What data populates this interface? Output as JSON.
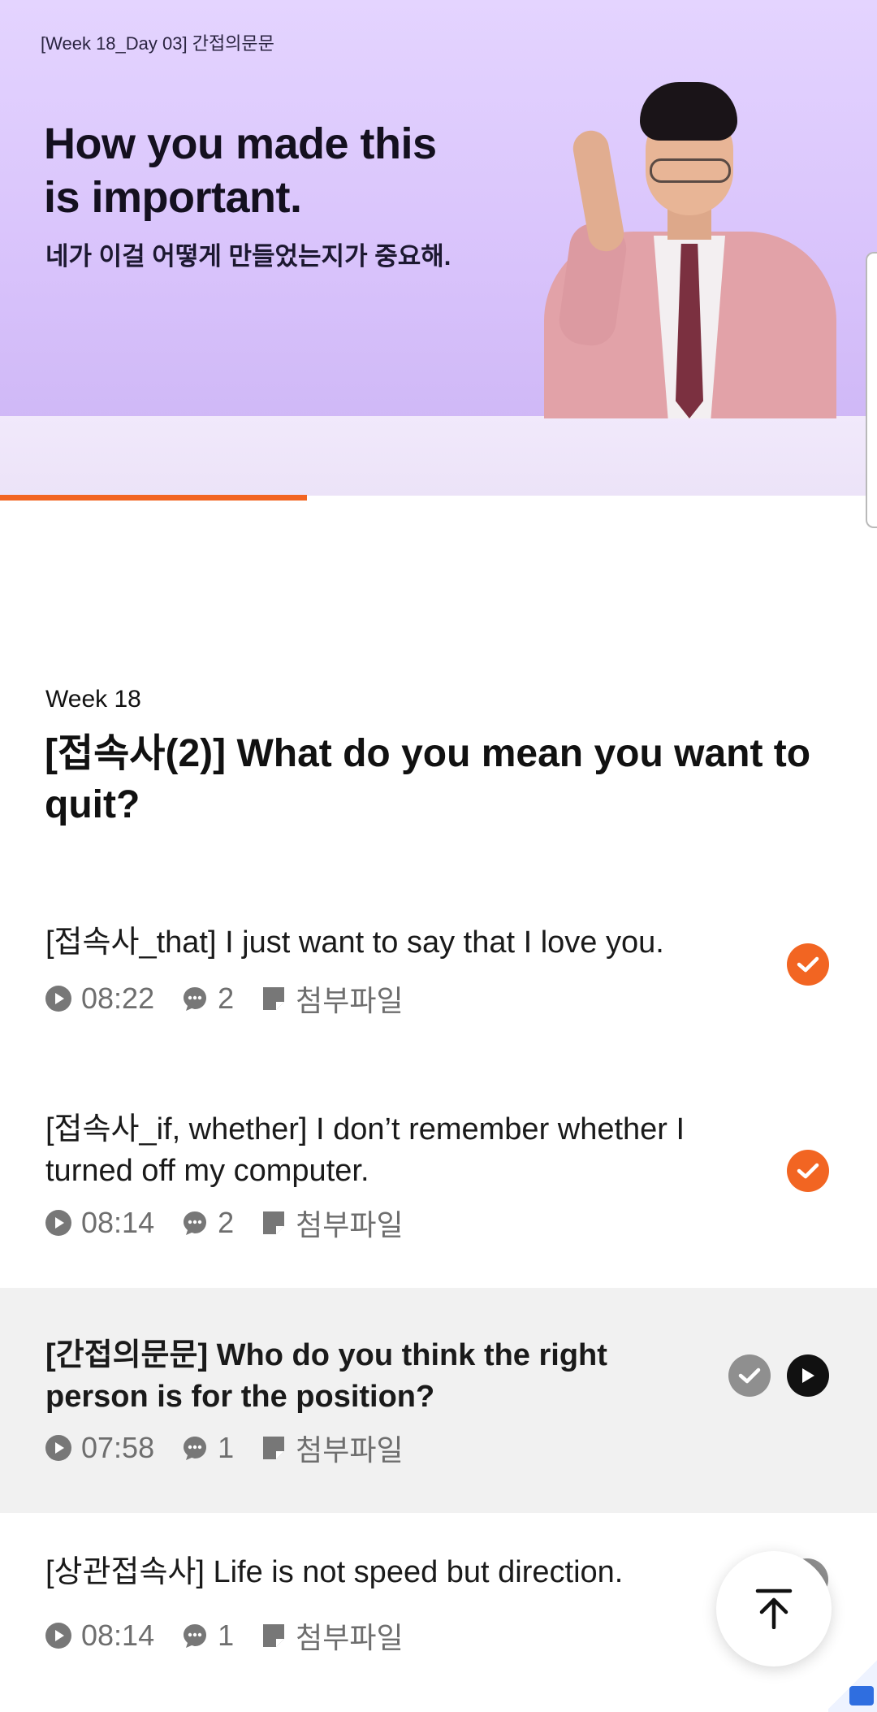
{
  "video": {
    "caption_small": "[Week 18_Day 03] 간접의문문",
    "headline_line1": "How you made this",
    "headline_line2": "is important.",
    "subline": "네가 이걸 어떻게 만들었는지가 중요해.",
    "progress_fraction": 0.35,
    "accent_color": "#f26522"
  },
  "course": {
    "week_label": "Week 18",
    "title": "[접속사(2)] What do you mean you want to quit?"
  },
  "lessons": [
    {
      "title": "[접속사_that] I just want to say that I love you.",
      "duration": "08:22",
      "comments": "2",
      "attachment": "첨부파일",
      "completed": true,
      "active": false
    },
    {
      "title": "[접속사_if, whether] I don’t remember whether I turned off my computer.",
      "duration": "08:14",
      "comments": "2",
      "attachment": "첨부파일",
      "completed": true,
      "active": false
    },
    {
      "title": "[간접의문문] Who do you think the right person is for the position?",
      "duration": "07:58",
      "comments": "1",
      "attachment": "첨부파일",
      "completed": false,
      "active": true
    },
    {
      "title": "[상관접속사] Life is not speed but direction.",
      "duration": "08:14",
      "comments": "1",
      "attachment": "첨부파일",
      "completed": false,
      "active": false
    }
  ],
  "icons": {
    "play": "play-circle-icon",
    "comment": "comment-bubble-icon",
    "attachment": "attachment-note-icon",
    "check": "check-icon",
    "scroll_top": "arrow-up-to-top-icon"
  }
}
